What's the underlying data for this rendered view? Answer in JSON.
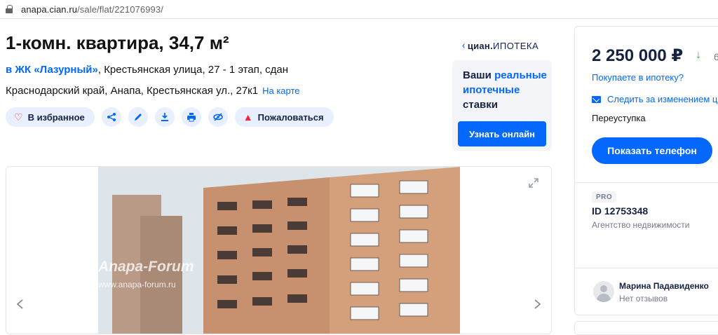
{
  "browser": {
    "url_domain": "anapa.cian.ru",
    "url_path": "/sale/flat/221076993/"
  },
  "listing": {
    "title": "1-комн. квартира, 34,7 м²",
    "complex_link": "в ЖК «Лазурный»",
    "complex_rest": ", Крестьянская улица, 27 - 1 этап, сдан",
    "address": "Краснодарский край, Анапа, Крестьянская ул., 27к1",
    "map_link": "На карте"
  },
  "actions": {
    "favorite": "В избранное",
    "report": "Пожаловаться",
    "icons": [
      "share-icon",
      "edit-icon",
      "download-icon",
      "print-icon",
      "hide-icon"
    ]
  },
  "mortgage": {
    "logo_brand": "циан",
    "logo_sub": "ИПОТЕКА",
    "text_1": "Ваши ",
    "text_hl": "реальные ипотечные",
    "text_2": " ставки",
    "button": "Узнать онлайн"
  },
  "gallery": {
    "watermark": "Anapa-Forum",
    "watermark_url": "www.anapa-forum.ru"
  },
  "sidebar": {
    "price": "2 250 000 ₽",
    "price_extra": "6",
    "mortgage_link": "Покупаете в ипотеку?",
    "follow_link": "Следить за изменением ц",
    "deal_type": "Переуступка",
    "phone_button": "Показать телефон",
    "pro_badge": "PRO",
    "agent_id": "ID 12753348",
    "agent_type": "Агентство недвижимости",
    "reviewer_name": "Марина Падавиденко",
    "reviews": "Нет отзывов"
  },
  "colors": {
    "accent": "#0468ff",
    "danger": "#ff1f34",
    "price_down": "#2bb73a",
    "pill_bg": "#e8f0ff"
  }
}
